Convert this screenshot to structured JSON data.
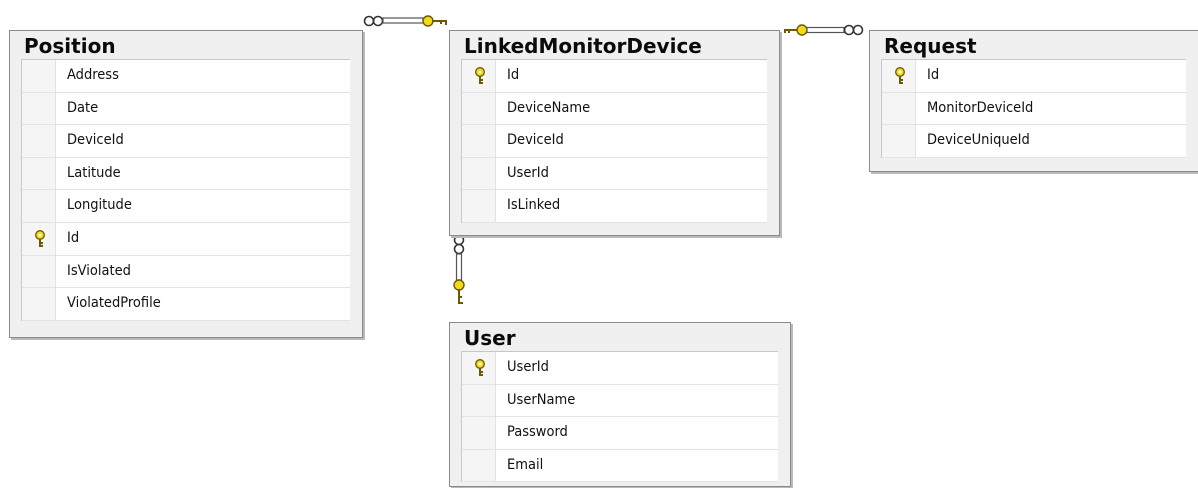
{
  "diagram": {
    "tables": [
      {
        "id": "position",
        "title": "Position",
        "columns": [
          {
            "name": "Address",
            "primary_key": false
          },
          {
            "name": "Date",
            "primary_key": false
          },
          {
            "name": "DeviceId",
            "primary_key": false
          },
          {
            "name": "Latitude",
            "primary_key": false
          },
          {
            "name": "Longitude",
            "primary_key": false
          },
          {
            "name": "Id",
            "primary_key": true
          },
          {
            "name": "IsViolated",
            "primary_key": false
          },
          {
            "name": "ViolatedProfile",
            "primary_key": false
          }
        ]
      },
      {
        "id": "linkedmonitordevice",
        "title": "LinkedMonitorDevice",
        "columns": [
          {
            "name": "Id",
            "primary_key": true
          },
          {
            "name": "DeviceName",
            "primary_key": false
          },
          {
            "name": "DeviceId",
            "primary_key": false
          },
          {
            "name": "UserId",
            "primary_key": false
          },
          {
            "name": "IsLinked",
            "primary_key": false
          }
        ]
      },
      {
        "id": "request",
        "title": "Request",
        "columns": [
          {
            "name": "Id",
            "primary_key": true
          },
          {
            "name": "MonitorDeviceId",
            "primary_key": false
          },
          {
            "name": "DeviceUniqueId",
            "primary_key": false
          }
        ]
      },
      {
        "id": "user",
        "title": "User",
        "columns": [
          {
            "name": "UserId",
            "primary_key": true
          },
          {
            "name": "UserName",
            "primary_key": false
          },
          {
            "name": "Password",
            "primary_key": false
          },
          {
            "name": "Email",
            "primary_key": false
          }
        ]
      }
    ],
    "relationships": [
      {
        "one": "linkedmonitordevice",
        "many": "position"
      },
      {
        "one": "linkedmonitordevice",
        "many": "request"
      },
      {
        "one": "user",
        "many": "linkedmonitordevice"
      }
    ],
    "colors": {
      "key": "#f2d91c",
      "key_outline": "#6b5a00",
      "border": "#8a8a8a",
      "header_bg": "#f0f0f0"
    }
  }
}
